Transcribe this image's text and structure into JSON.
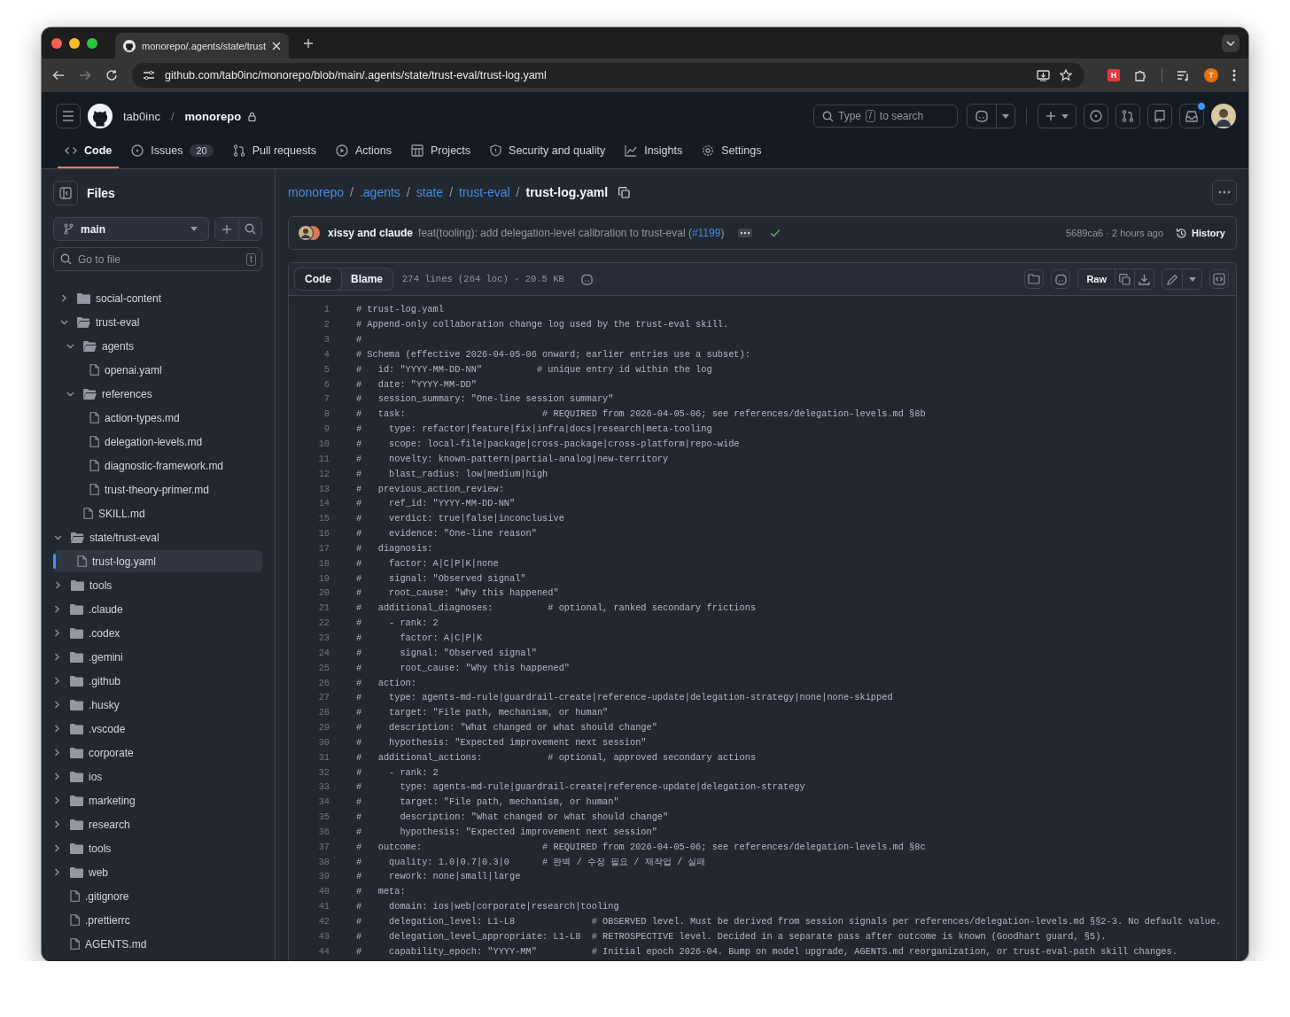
{
  "browser": {
    "tab_title": "monorepo/.agents/state/trust",
    "url": "github.com/tab0inc/monorepo/blob/main/.agents/state/trust-eval/trust-log.yaml",
    "extension_badge": "H",
    "profile_initial": "T"
  },
  "header": {
    "crumbs": [
      {
        "label": "tab0inc",
        "kind": "owner"
      },
      {
        "label": "/",
        "kind": "separator"
      },
      {
        "label": "monorepo",
        "kind": "repo"
      }
    ],
    "search": {
      "before": "Type",
      "key": "/",
      "after": "to search"
    },
    "notifications_unread": true
  },
  "nav_tabs": [
    {
      "label": "Code",
      "selected": true
    },
    {
      "label": "Issues",
      "count": "20",
      "selected": false
    },
    {
      "label": "Pull requests",
      "selected": false
    },
    {
      "label": "Actions",
      "selected": false
    },
    {
      "label": "Projects",
      "selected": false
    },
    {
      "label": "Security and quality",
      "selected": false
    },
    {
      "label": "Insights",
      "selected": false
    },
    {
      "label": "Settings",
      "selected": false
    }
  ],
  "sidebar": {
    "title": "Files",
    "branch": "main",
    "go_to_file": {
      "placeholder": "Go to file",
      "shortcut": "t"
    },
    "tree": [
      {
        "children": [
          {
            "children": [
              {
                "name": "social-content",
                "kind": "folder",
                "expanded": false,
                "selected": false
              },
              {
                "name": "trust-eval",
                "kind": "folder",
                "expanded": true,
                "selected": false,
                "children": [
                  {
                    "name": "agents",
                    "kind": "folder",
                    "expanded": true,
                    "selected": false,
                    "children": [
                      {
                        "name": "openai.yaml",
                        "kind": "file",
                        "selected": false
                      }
                    ]
                  },
                  {
                    "name": "references",
                    "kind": "folder",
                    "expanded": true,
                    "selected": false,
                    "children": [
                      {
                        "name": "action-types.md",
                        "kind": "file",
                        "selected": false
                      },
                      {
                        "name": "delegation-levels.md",
                        "kind": "file",
                        "selected": false
                      },
                      {
                        "name": "diagnostic-framework.md",
                        "kind": "file",
                        "selected": false
                      },
                      {
                        "name": "trust-theory-primer.md",
                        "kind": "file",
                        "selected": false
                      }
                    ]
                  },
                  {
                    "name": "SKILL.md",
                    "kind": "file",
                    "selected": false
                  }
                ]
              }
            ]
          },
          {
            "name": "state/trust-eval",
            "kind": "folder",
            "expanded": true,
            "selected": false,
            "children": [
              {
                "name": "trust-log.yaml",
                "kind": "file",
                "selected": true
              }
            ]
          },
          {
            "name": "tools",
            "kind": "folder",
            "expanded": false,
            "selected": false
          }
        ]
      },
      {
        "name": ".claude",
        "kind": "folder",
        "expanded": false,
        "selected": false
      },
      {
        "name": ".codex",
        "kind": "folder",
        "expanded": false,
        "selected": false
      },
      {
        "name": ".gemini",
        "kind": "folder",
        "expanded": false,
        "selected": false
      },
      {
        "name": ".github",
        "kind": "folder",
        "expanded": false,
        "selected": false
      },
      {
        "name": ".husky",
        "kind": "folder",
        "expanded": false,
        "selected": false
      },
      {
        "name": ".vscode",
        "kind": "folder",
        "expanded": false,
        "selected": false
      },
      {
        "name": "corporate",
        "kind": "folder",
        "expanded": false,
        "selected": false
      },
      {
        "name": "ios",
        "kind": "folder",
        "expanded": false,
        "selected": false
      },
      {
        "name": "marketing",
        "kind": "folder",
        "expanded": false,
        "selected": false
      },
      {
        "name": "research",
        "kind": "folder",
        "expanded": false,
        "selected": false
      },
      {
        "name": "tools",
        "kind": "folder",
        "expanded": false,
        "selected": false
      },
      {
        "name": "web",
        "kind": "folder",
        "expanded": false,
        "selected": false
      },
      {
        "name": ".gitignore",
        "kind": "file",
        "selected": false
      },
      {
        "name": ".prettierrc",
        "kind": "file",
        "selected": false
      },
      {
        "name": "AGENTS.md",
        "kind": "file",
        "selected": false
      }
    ]
  },
  "breadcrumb": [
    {
      "label": "monorepo",
      "kind": "link"
    },
    {
      "label": "/",
      "kind": "separator"
    },
    {
      "label": ".agents",
      "kind": "link"
    },
    {
      "label": "/",
      "kind": "separator"
    },
    {
      "label": "state",
      "kind": "link"
    },
    {
      "label": "/",
      "kind": "separator"
    },
    {
      "label": "trust-eval",
      "kind": "link"
    },
    {
      "label": "/",
      "kind": "separator"
    },
    {
      "label": "trust-log.yaml",
      "kind": "current"
    }
  ],
  "commit": {
    "authors": "xissy and claude",
    "message": "feat(tooling): add delegation-level calibration to trust-eval (",
    "pr": "#1199",
    "message_end": ")",
    "checks_passed": true,
    "sha_time": "5689ca6 · 2 hours ago",
    "history": "History"
  },
  "code_view": {
    "tabs": [
      {
        "label": "Code",
        "selected": true
      },
      {
        "label": "Blame",
        "selected": false
      }
    ],
    "file_info": "274 lines (264 loc) · 20.5 KB",
    "raw": "Raw",
    "lines": [
      {
        "n": "1",
        "text": "# trust-log.yaml"
      },
      {
        "n": "2",
        "text": "# Append-only collaboration change log used by the trust-eval skill."
      },
      {
        "n": "3",
        "text": "#"
      },
      {
        "n": "4",
        "text": "# Schema (effective 2026-04-05-06 onward; earlier entries use a subset):"
      },
      {
        "n": "5",
        "text": "#   id: \"YYYY-MM-DD-NN\"          # unique entry id within the log"
      },
      {
        "n": "6",
        "text": "#   date: \"YYYY-MM-DD\""
      },
      {
        "n": "7",
        "text": "#   session_summary: \"One-line session summary\""
      },
      {
        "n": "8",
        "text": "#   task:                         # REQUIRED from 2026-04-05-06; see references/delegation-levels.md §8b"
      },
      {
        "n": "9",
        "text": "#     type: refactor|feature|fix|infra|docs|research|meta-tooling"
      },
      {
        "n": "10",
        "text": "#     scope: local-file|package|cross-package|cross-platform|repo-wide"
      },
      {
        "n": "11",
        "text": "#     novelty: known-pattern|partial-analog|new-territory"
      },
      {
        "n": "12",
        "text": "#     blast_radius: low|medium|high"
      },
      {
        "n": "13",
        "text": "#   previous_action_review:"
      },
      {
        "n": "14",
        "text": "#     ref_id: \"YYYY-MM-DD-NN\""
      },
      {
        "n": "15",
        "text": "#     verdict: true|false|inconclusive"
      },
      {
        "n": "16",
        "text": "#     evidence: \"One-line reason\""
      },
      {
        "n": "17",
        "text": "#   diagnosis:"
      },
      {
        "n": "18",
        "text": "#     factor: A|C|P|K|none"
      },
      {
        "n": "19",
        "text": "#     signal: \"Observed signal\""
      },
      {
        "n": "20",
        "text": "#     root_cause: \"Why this happened\""
      },
      {
        "n": "21",
        "text": "#   additional_diagnoses:          # optional, ranked secondary frictions"
      },
      {
        "n": "22",
        "text": "#     - rank: 2"
      },
      {
        "n": "23",
        "text": "#       factor: A|C|P|K"
      },
      {
        "n": "24",
        "text": "#       signal: \"Observed signal\""
      },
      {
        "n": "25",
        "text": "#       root_cause: \"Why this happened\""
      },
      {
        "n": "26",
        "text": "#   action:"
      },
      {
        "n": "27",
        "text": "#     type: agents-md-rule|guardrail-create|reference-update|delegation-strategy|none|none-skipped"
      },
      {
        "n": "28",
        "text": "#     target: \"File path, mechanism, or human\""
      },
      {
        "n": "29",
        "text": "#     description: \"What changed or what should change\""
      },
      {
        "n": "30",
        "text": "#     hypothesis: \"Expected improvement next session\""
      },
      {
        "n": "31",
        "text": "#   additional_actions:            # optional, approved secondary actions"
      },
      {
        "n": "32",
        "text": "#     - rank: 2"
      },
      {
        "n": "33",
        "text": "#       type: agents-md-rule|guardrail-create|reference-update|delegation-strategy"
      },
      {
        "n": "34",
        "text": "#       target: \"File path, mechanism, or human\""
      },
      {
        "n": "35",
        "text": "#       description: \"What changed or what should change\""
      },
      {
        "n": "36",
        "text": "#       hypothesis: \"Expected improvement next session\""
      },
      {
        "n": "37",
        "text": "#   outcome:                      # REQUIRED from 2026-04-05-06; see references/delegation-levels.md §8c"
      },
      {
        "n": "38",
        "text": "#     quality: 1.0|0.7|0.3|0      # 완벽 / 수정 필요 / 재작업 / 실패"
      },
      {
        "n": "39",
        "text": "#     rework: none|small|large"
      },
      {
        "n": "40",
        "text": "#   meta:"
      },
      {
        "n": "41",
        "text": "#     domain: ios|web|corporate|research|tooling"
      },
      {
        "n": "42",
        "text": "#     delegation_level: L1-L8              # OBSERVED level. Must be derived from session signals per references/delegation-levels.md §§2-3. No default value."
      },
      {
        "n": "43",
        "text": "#     delegation_level_appropriate: L1-L8  # RETROSPECTIVE level. Decided in a separate pass after outcome is known (Goodhart guard, §5)."
      },
      {
        "n": "44",
        "text": "#     capability_epoch: \"YYYY-MM\"          # Initial epoch 2026-04. Bump on model upgrade, AGENTS.md reorganization, or trust-eval-path skill changes."
      }
    ]
  }
}
